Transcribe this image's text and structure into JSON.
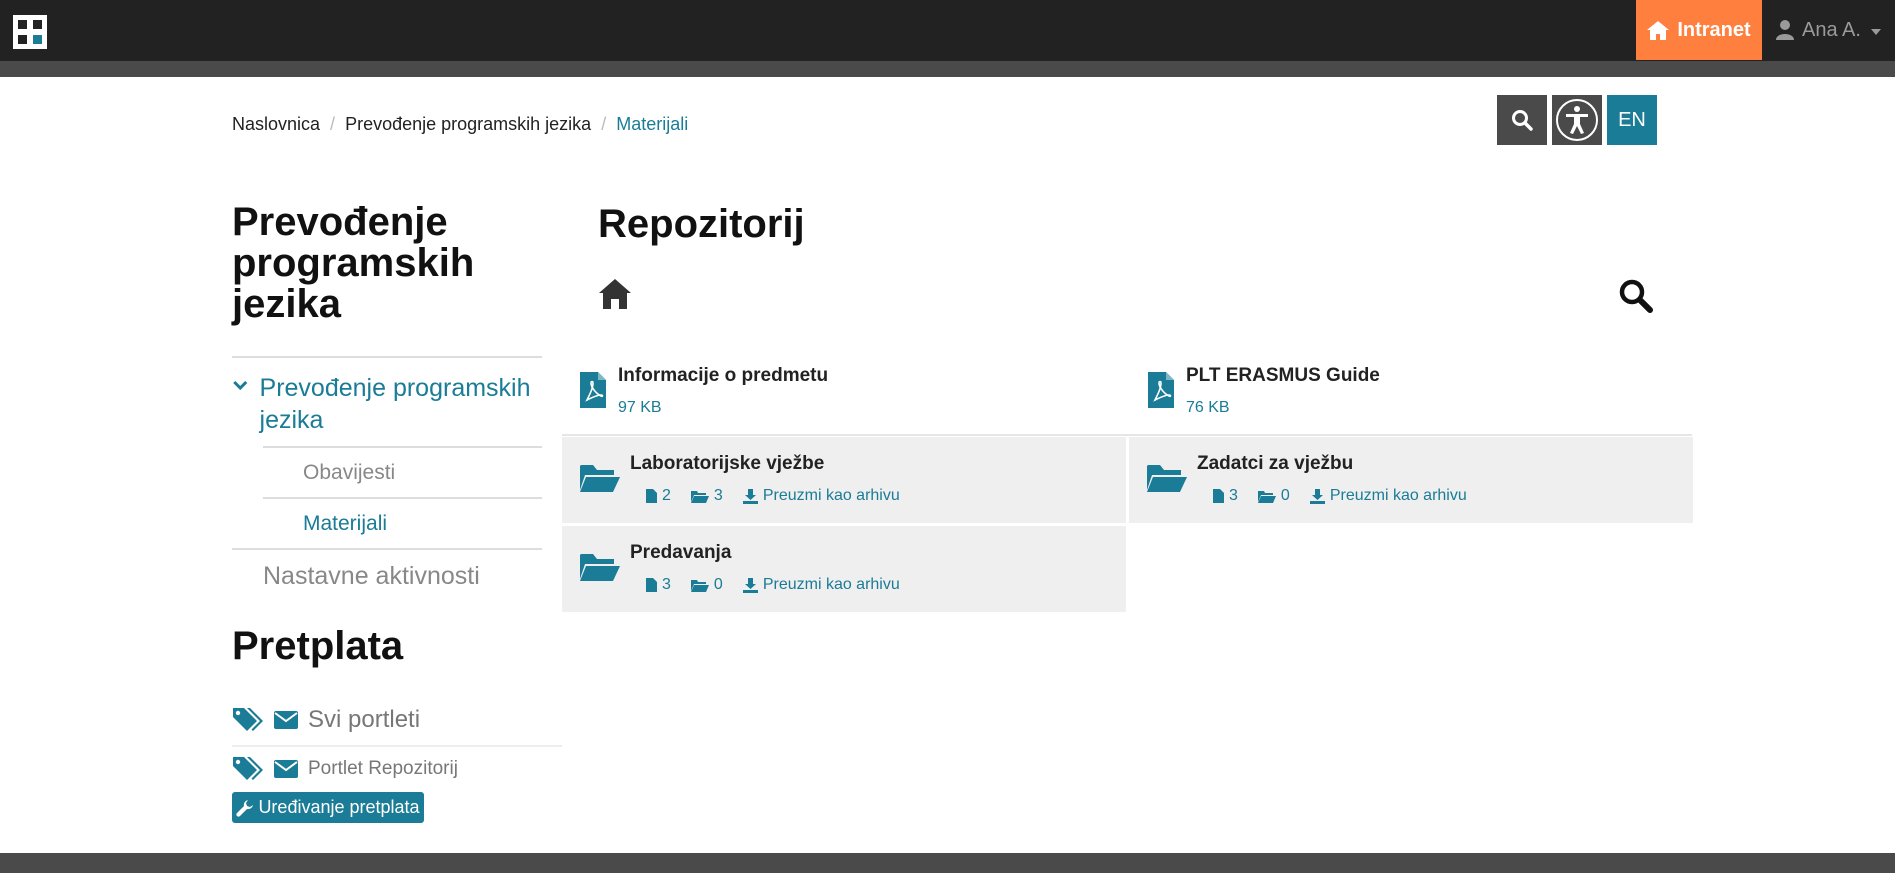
{
  "topbar": {
    "intranet_label": "Intranet",
    "user_name": "Ana A.",
    "colors": {
      "bar": "#222222",
      "intranet": "#ff7f3f",
      "accent": "#1a7c96"
    }
  },
  "breadcrumb": {
    "items": [
      "Naslovnica",
      "Prevođenje programskih jezika",
      "Materijali"
    ],
    "separator": "/"
  },
  "tools": {
    "search_icon": "search-icon",
    "accessibility_icon": "accessibility-icon",
    "lang_label": "EN"
  },
  "sidebar": {
    "title": "Prevođenje programskih jezika",
    "nav": {
      "top_label": "Prevođenje programskih jezika",
      "sub_items": [
        "Obavijesti",
        "Materijali"
      ],
      "second_label": "Nastavne aktivnosti"
    },
    "subscription": {
      "title": "Pretplata",
      "row1_label": "Svi portleti",
      "row2_label": "Portlet Repozitorij",
      "edit_label": "Uređivanje pretplata"
    }
  },
  "main": {
    "title": "Repozitorij",
    "files": [
      {
        "name": "Informacije o predmetu",
        "size": "97 KB"
      },
      {
        "name": "PLT ERASMUS Guide",
        "size": "76 KB"
      }
    ],
    "folders": [
      {
        "name": "Laboratorijske vježbe",
        "files": "2",
        "folders": "3",
        "download": "Preuzmi kao arhivu"
      },
      {
        "name": "Zadatci za vježbu",
        "files": "3",
        "folders": "0",
        "download": "Preuzmi kao arhivu"
      },
      {
        "name": "Predavanja",
        "files": "3",
        "folders": "0",
        "download": "Preuzmi kao arhivu"
      }
    ]
  }
}
